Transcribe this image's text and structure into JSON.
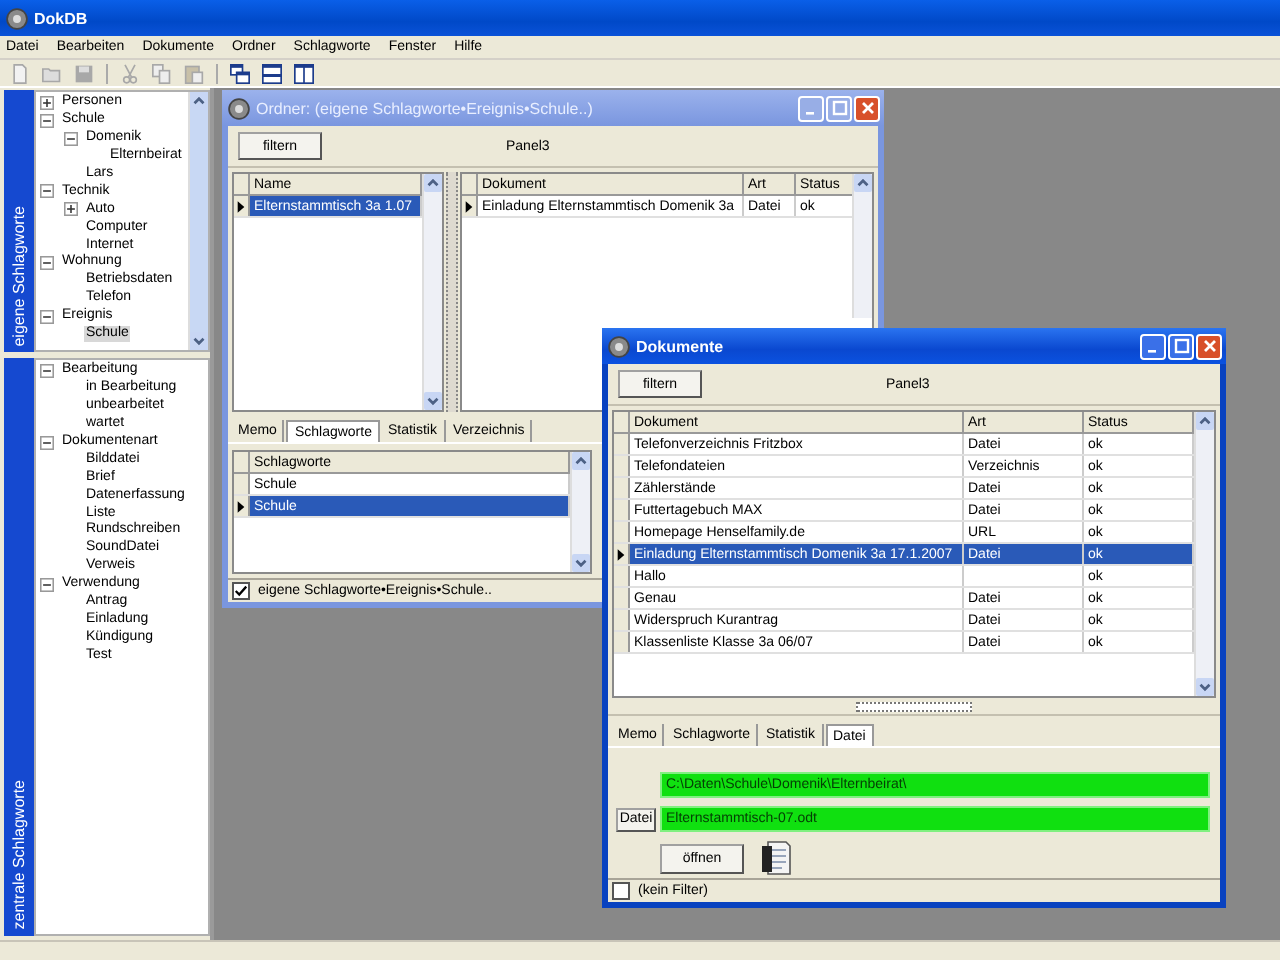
{
  "app": {
    "title": "DokDB"
  },
  "menu": [
    "Datei",
    "Bearbeiten",
    "Dokumente",
    "Ordner",
    "Schlagworte",
    "Fenster",
    "Hilfe"
  ],
  "toolbar": [
    {
      "kind": "new",
      "disabled": true
    },
    {
      "kind": "open",
      "disabled": true
    },
    {
      "kind": "save",
      "disabled": true
    },
    {
      "kind": "cut",
      "disabled": true
    },
    {
      "kind": "copy",
      "disabled": true
    },
    {
      "kind": "paste",
      "disabled": true
    },
    {
      "kind": "cascade",
      "disabled": false
    },
    {
      "kind": "tile_horizontal",
      "disabled": false
    },
    {
      "kind": "tile_vertical",
      "disabled": false
    }
  ],
  "sidebar": {
    "sections": [
      {
        "tab_label": "eigene Schlagworte",
        "tree": [
          {
            "label": "Personen",
            "expanded": false,
            "selected": false
          },
          {
            "label": "Schule",
            "expanded": true,
            "selected": false,
            "children": [
              {
                "label": "Domenik",
                "expanded": true,
                "selected": false,
                "children": [
                  {
                    "label": "Elternbeirat",
                    "selected": false
                  }
                ]
              },
              {
                "label": "Lars",
                "selected": false
              }
            ]
          },
          {
            "label": "Technik",
            "expanded": true,
            "selected": false,
            "children": [
              {
                "label": "Auto",
                "expanded": false,
                "selected": false
              },
              {
                "label": "Computer",
                "selected": false
              },
              {
                "label": "Internet",
                "selected": false
              }
            ]
          },
          {
            "label": "Wohnung",
            "expanded": true,
            "selected": false,
            "children": [
              {
                "label": "Betriebsdaten",
                "selected": false
              },
              {
                "label": "Telefon",
                "selected": false
              }
            ]
          },
          {
            "label": "Ereignis",
            "expanded": true,
            "selected": false,
            "children": [
              {
                "label": "Schule",
                "selected": true
              }
            ]
          }
        ]
      },
      {
        "tab_label": "zentrale Schlagworte",
        "tree": [
          {
            "label": "Bearbeitung",
            "expanded": true,
            "selected": false,
            "children": [
              {
                "label": "in Bearbeitung",
                "selected": false
              },
              {
                "label": "unbearbeitet",
                "selected": false
              },
              {
                "label": "wartet",
                "selected": false
              }
            ]
          },
          {
            "label": "Dokumentenart",
            "expanded": true,
            "selected": false,
            "children": [
              {
                "label": "Bilddatei",
                "selected": false
              },
              {
                "label": "Brief",
                "selected": false
              },
              {
                "label": "Datenerfassung",
                "selected": false
              },
              {
                "label": "Liste",
                "selected": false
              },
              {
                "label": "Rundschreiben",
                "selected": false
              },
              {
                "label": "SoundDatei",
                "selected": false
              },
              {
                "label": "Verweis",
                "selected": false
              }
            ]
          },
          {
            "label": "Verwendung",
            "expanded": true,
            "selected": false,
            "children": [
              {
                "label": "Antrag",
                "selected": false
              },
              {
                "label": "Einladung",
                "selected": false
              },
              {
                "label": "Kündigung",
                "selected": false
              },
              {
                "label": "Test",
                "selected": false
              }
            ]
          }
        ]
      }
    ]
  },
  "ordner_window": {
    "title": "Ordner: (eigene Schlagworte•Ereignis•Schule..)",
    "active": false,
    "filter_button": "filtern",
    "panel_label": "Panel3",
    "left_grid": {
      "columns": [
        "Name"
      ],
      "rows": [
        {
          "cells": [
            "Elternstammtisch 3a 1.07"
          ],
          "current": true,
          "selected": true
        }
      ]
    },
    "right_grid": {
      "columns": [
        "Dokument",
        "Art",
        "Status"
      ],
      "rows": [
        {
          "cells": [
            "Einladung Elternstammtisch Domenik 3a",
            "Datei",
            "ok"
          ],
          "current": true,
          "selected": false
        }
      ]
    },
    "tabs": [
      {
        "label": "Memo",
        "selected": false
      },
      {
        "label": "Schlagworte",
        "selected": true
      },
      {
        "label": "Statistik",
        "selected": false
      },
      {
        "label": "Verzeichnis",
        "selected": false
      }
    ],
    "keyword_grid": {
      "columns": [
        "Schlagworte"
      ],
      "rows": [
        {
          "cells": [
            "Schule"
          ],
          "current": false,
          "selected": false
        },
        {
          "cells": [
            "Schule"
          ],
          "current": true,
          "selected": true
        }
      ]
    },
    "filter_checkbox": {
      "label": "eigene Schlagworte•Ereignis•Schule..",
      "checked": true
    }
  },
  "dokumente_window": {
    "title": "Dokumente",
    "active": true,
    "filter_button": "filtern",
    "panel_label": "Panel3",
    "grid": {
      "columns": [
        "Dokument",
        "Art",
        "Status"
      ],
      "rows": [
        {
          "cells": [
            "Telefonverzeichnis Fritzbox",
            "Datei",
            "ok"
          ],
          "current": false,
          "selected": false
        },
        {
          "cells": [
            "Telefondateien",
            "Verzeichnis",
            "ok"
          ],
          "current": false,
          "selected": false
        },
        {
          "cells": [
            "Zählerstände",
            "Datei",
            "ok"
          ],
          "current": false,
          "selected": false
        },
        {
          "cells": [
            "Futtertagebuch MAX",
            "Datei",
            "ok"
          ],
          "current": false,
          "selected": false
        },
        {
          "cells": [
            "Homepage Henselfamily.de",
            "URL",
            "ok"
          ],
          "current": false,
          "selected": false
        },
        {
          "cells": [
            "Einladung Elternstammtisch Domenik 3a 17.1.2007",
            "Datei",
            "ok"
          ],
          "current": true,
          "selected": true
        },
        {
          "cells": [
            "Hallo",
            "",
            "ok"
          ],
          "current": false,
          "selected": false
        },
        {
          "cells": [
            "Genau",
            "Datei",
            "ok"
          ],
          "current": false,
          "selected": false
        },
        {
          "cells": [
            "Widerspruch Kurantrag",
            "Datei",
            "ok"
          ],
          "current": false,
          "selected": false
        },
        {
          "cells": [
            "Klassenliste Klasse 3a 06/07",
            "Datei",
            "ok"
          ],
          "current": false,
          "selected": false
        }
      ]
    },
    "tabs": [
      {
        "label": "Memo",
        "selected": false
      },
      {
        "label": "Schlagworte",
        "selected": false
      },
      {
        "label": "Statistik",
        "selected": false
      },
      {
        "label": "Datei",
        "selected": true
      }
    ],
    "path_field": "C:\\Daten\\Schule\\Domenik\\Elternbeirat\\",
    "file_button": "Datei",
    "file_field": "Elternstammtisch-07.odt",
    "open_button": "öffnen",
    "filter_checkbox": {
      "label": "(kein Filter)",
      "checked": false
    }
  }
}
